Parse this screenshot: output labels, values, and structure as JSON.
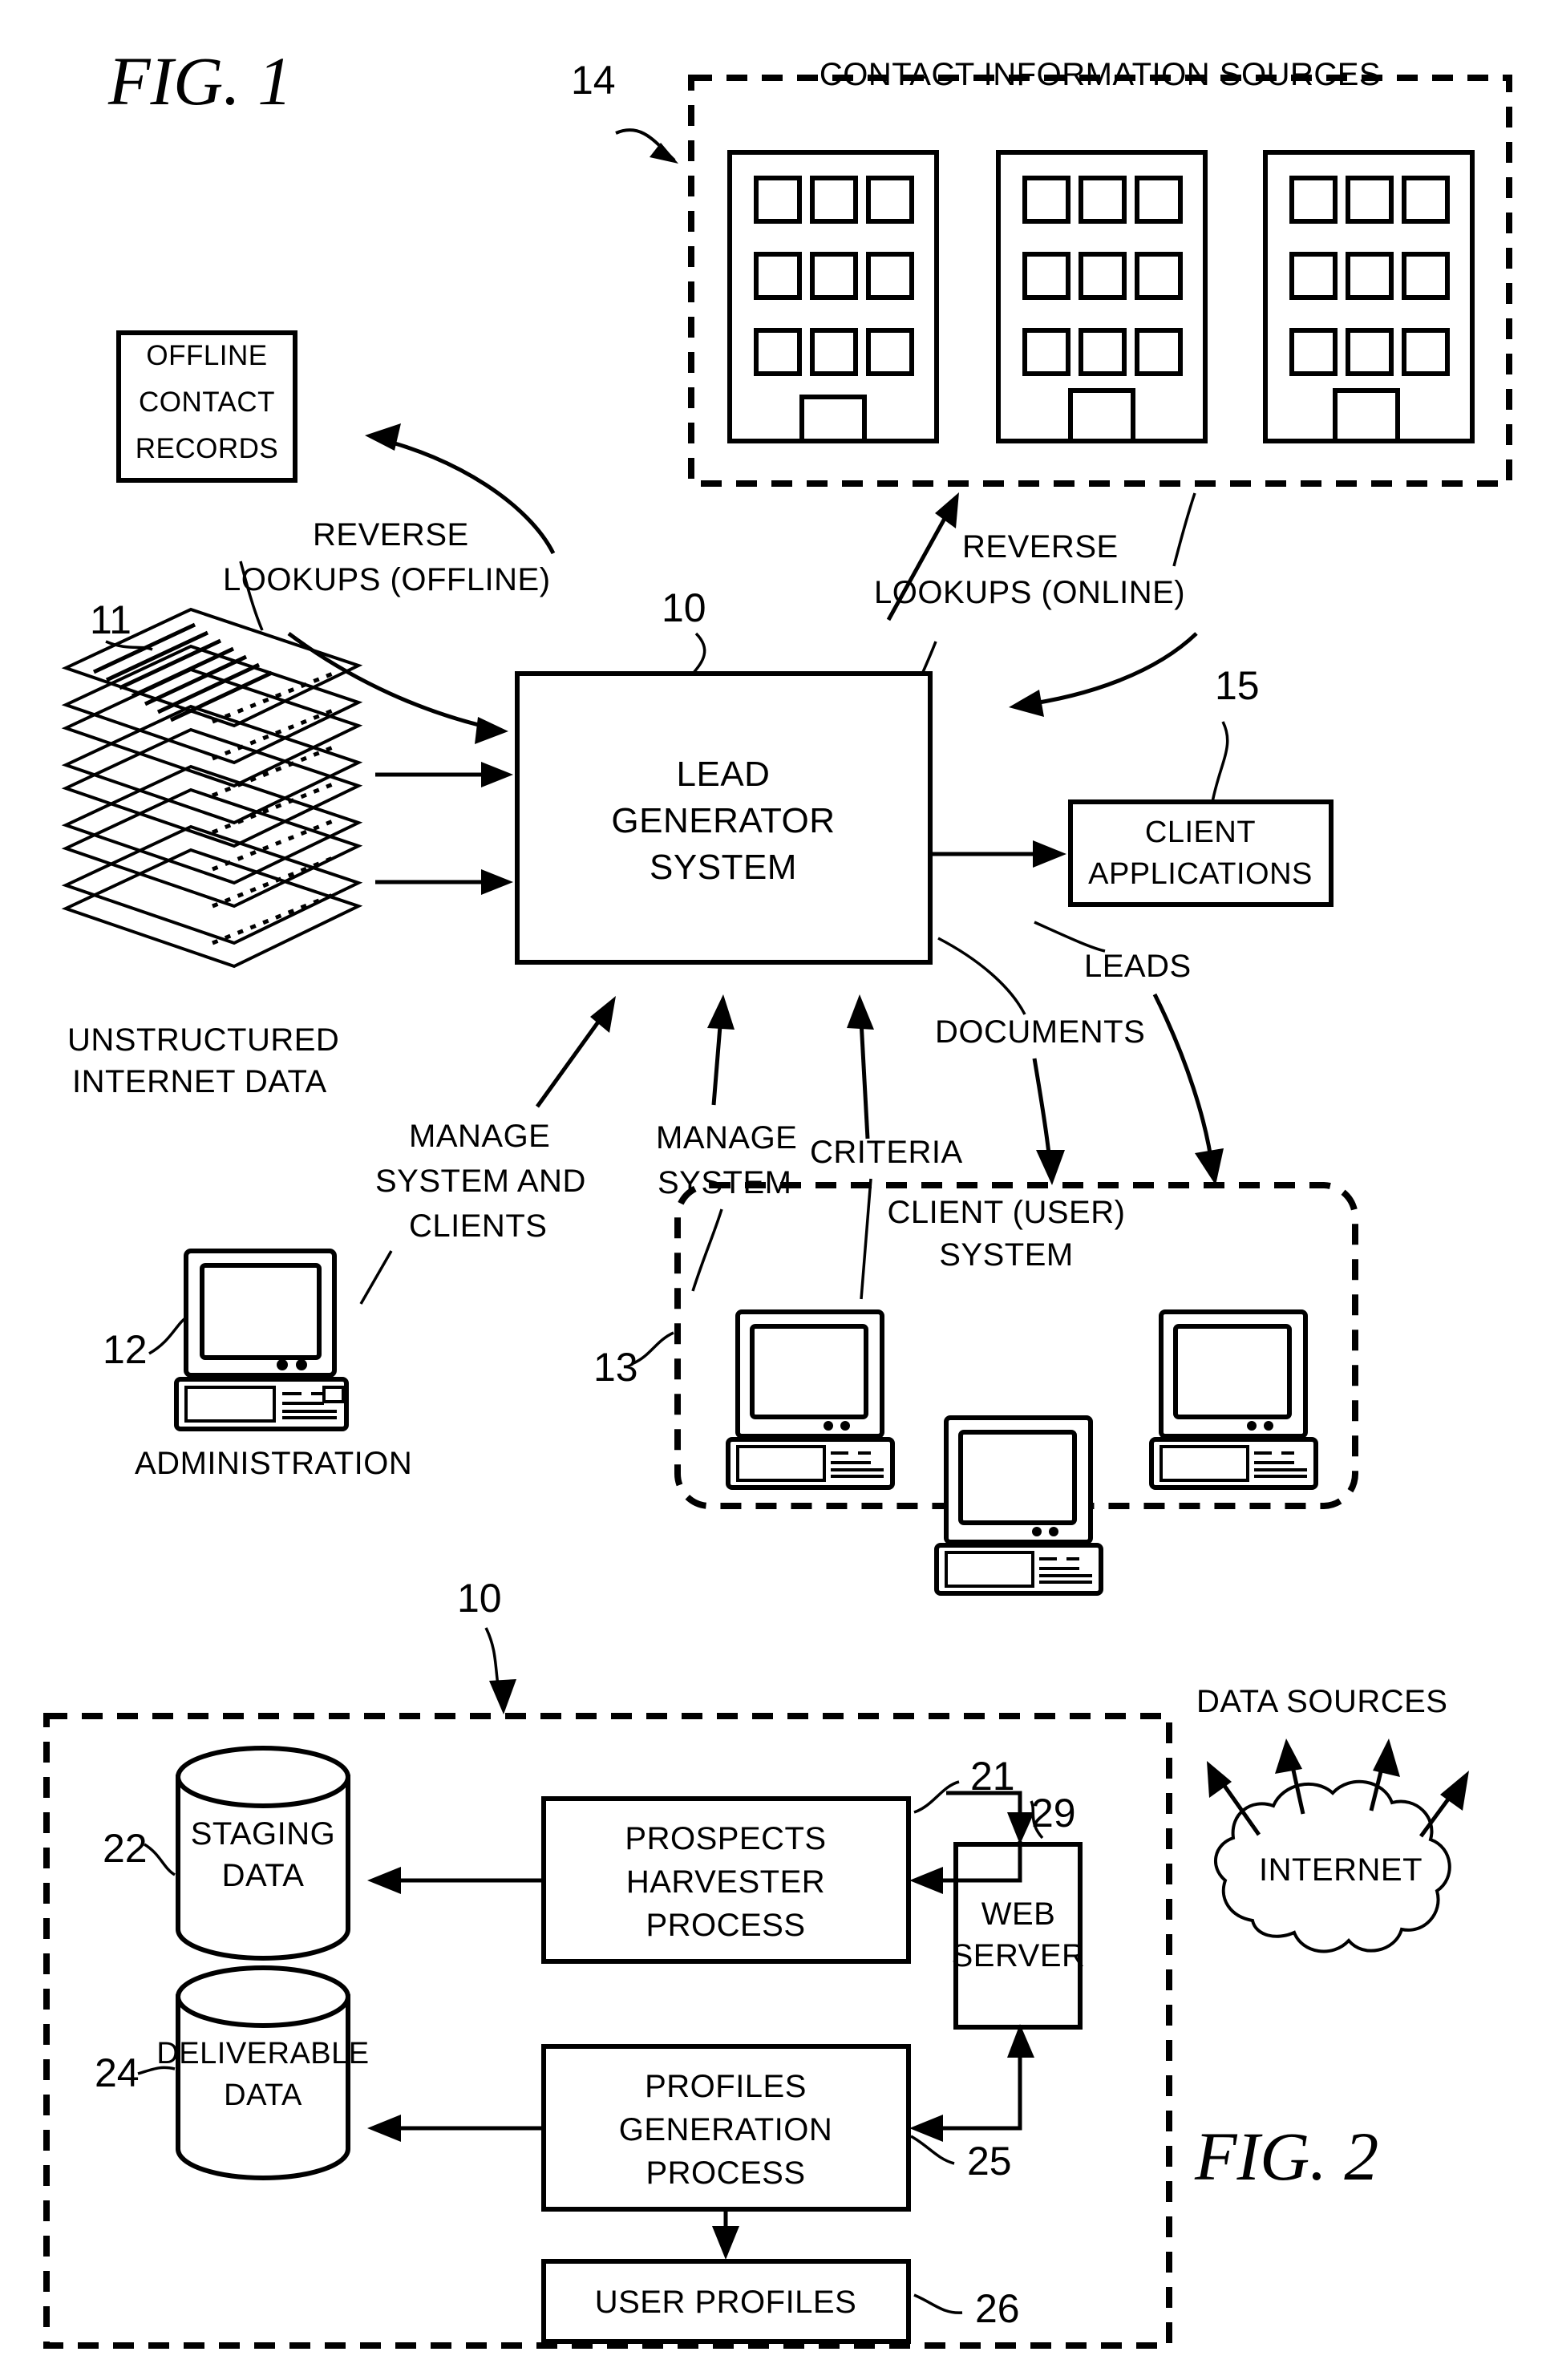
{
  "document": {
    "type": "patent-drawing-sheet",
    "figures": [
      {
        "id": "fig1",
        "label": "FIG.  1",
        "title_ref": "1"
      },
      {
        "id": "fig2",
        "label": "FIG.  2",
        "title_ref": "2"
      }
    ]
  },
  "fig1": {
    "label": "FIG.  1",
    "contact_sources": {
      "title": "CONTACT INFORMATION SOURCES",
      "ref": "14",
      "building_count": 3,
      "windows_per_building": 9
    },
    "offline_records": {
      "line1": "OFFLINE",
      "line2": "CONTACT",
      "line3": "RECORDS"
    },
    "reverse_offline": {
      "line1": "REVERSE",
      "line2": "LOOKUPS (OFFLINE)"
    },
    "reverse_online": {
      "line1": "REVERSE",
      "line2": "LOOKUPS (ONLINE)"
    },
    "lead_generator": {
      "line1": "LEAD",
      "line2": "GENERATOR",
      "line3": "SYSTEM",
      "ref": "10"
    },
    "unstructured": {
      "line1": "UNSTRUCTURED",
      "line2": "INTERNET DATA",
      "ref": "11"
    },
    "client_applications": {
      "line1": "CLIENT",
      "line2": "APPLICATIONS",
      "ref": "15"
    },
    "administration": {
      "label": "ADMINISTRATION",
      "ref": "12"
    },
    "manage_system_clients": {
      "line1": "MANAGE",
      "line2": "SYSTEM AND",
      "line3": "CLIENTS"
    },
    "manage_system": {
      "line1": "MANAGE",
      "line2": "SYSTEM"
    },
    "criteria": {
      "label": "CRITERIA"
    },
    "documents": {
      "label": "DOCUMENTS"
    },
    "leads": {
      "label": "LEADS"
    },
    "client_user_system": {
      "line1": "CLIENT (USER)",
      "line2": "SYSTEM",
      "ref": "13",
      "computer_count": 3
    }
  },
  "fig2": {
    "label": "FIG.  2",
    "system_ref": "10",
    "staging_data": {
      "line1": "STAGING",
      "line2": "DATA",
      "ref": "22"
    },
    "prospects_harvester": {
      "line1": "PROSPECTS",
      "line2": "HARVESTER",
      "line3": "PROCESS",
      "ref": "21"
    },
    "web_server": {
      "line1": "WEB",
      "line2": "SERVER",
      "ref": "29"
    },
    "deliverable_data": {
      "line1": "DELIVERABLE",
      "line2": "DATA",
      "ref": "24"
    },
    "profiles_generation": {
      "line1": "PROFILES",
      "line2": "GENERATION",
      "line3": "PROCESS",
      "ref": "25"
    },
    "user_profiles": {
      "label": "USER PROFILES",
      "ref": "26"
    },
    "internet": {
      "label": "INTERNET",
      "caption": "DATA SOURCES",
      "arrow_count": 4
    }
  },
  "colors": {
    "ink": "#000000",
    "paper": "#ffffff"
  }
}
